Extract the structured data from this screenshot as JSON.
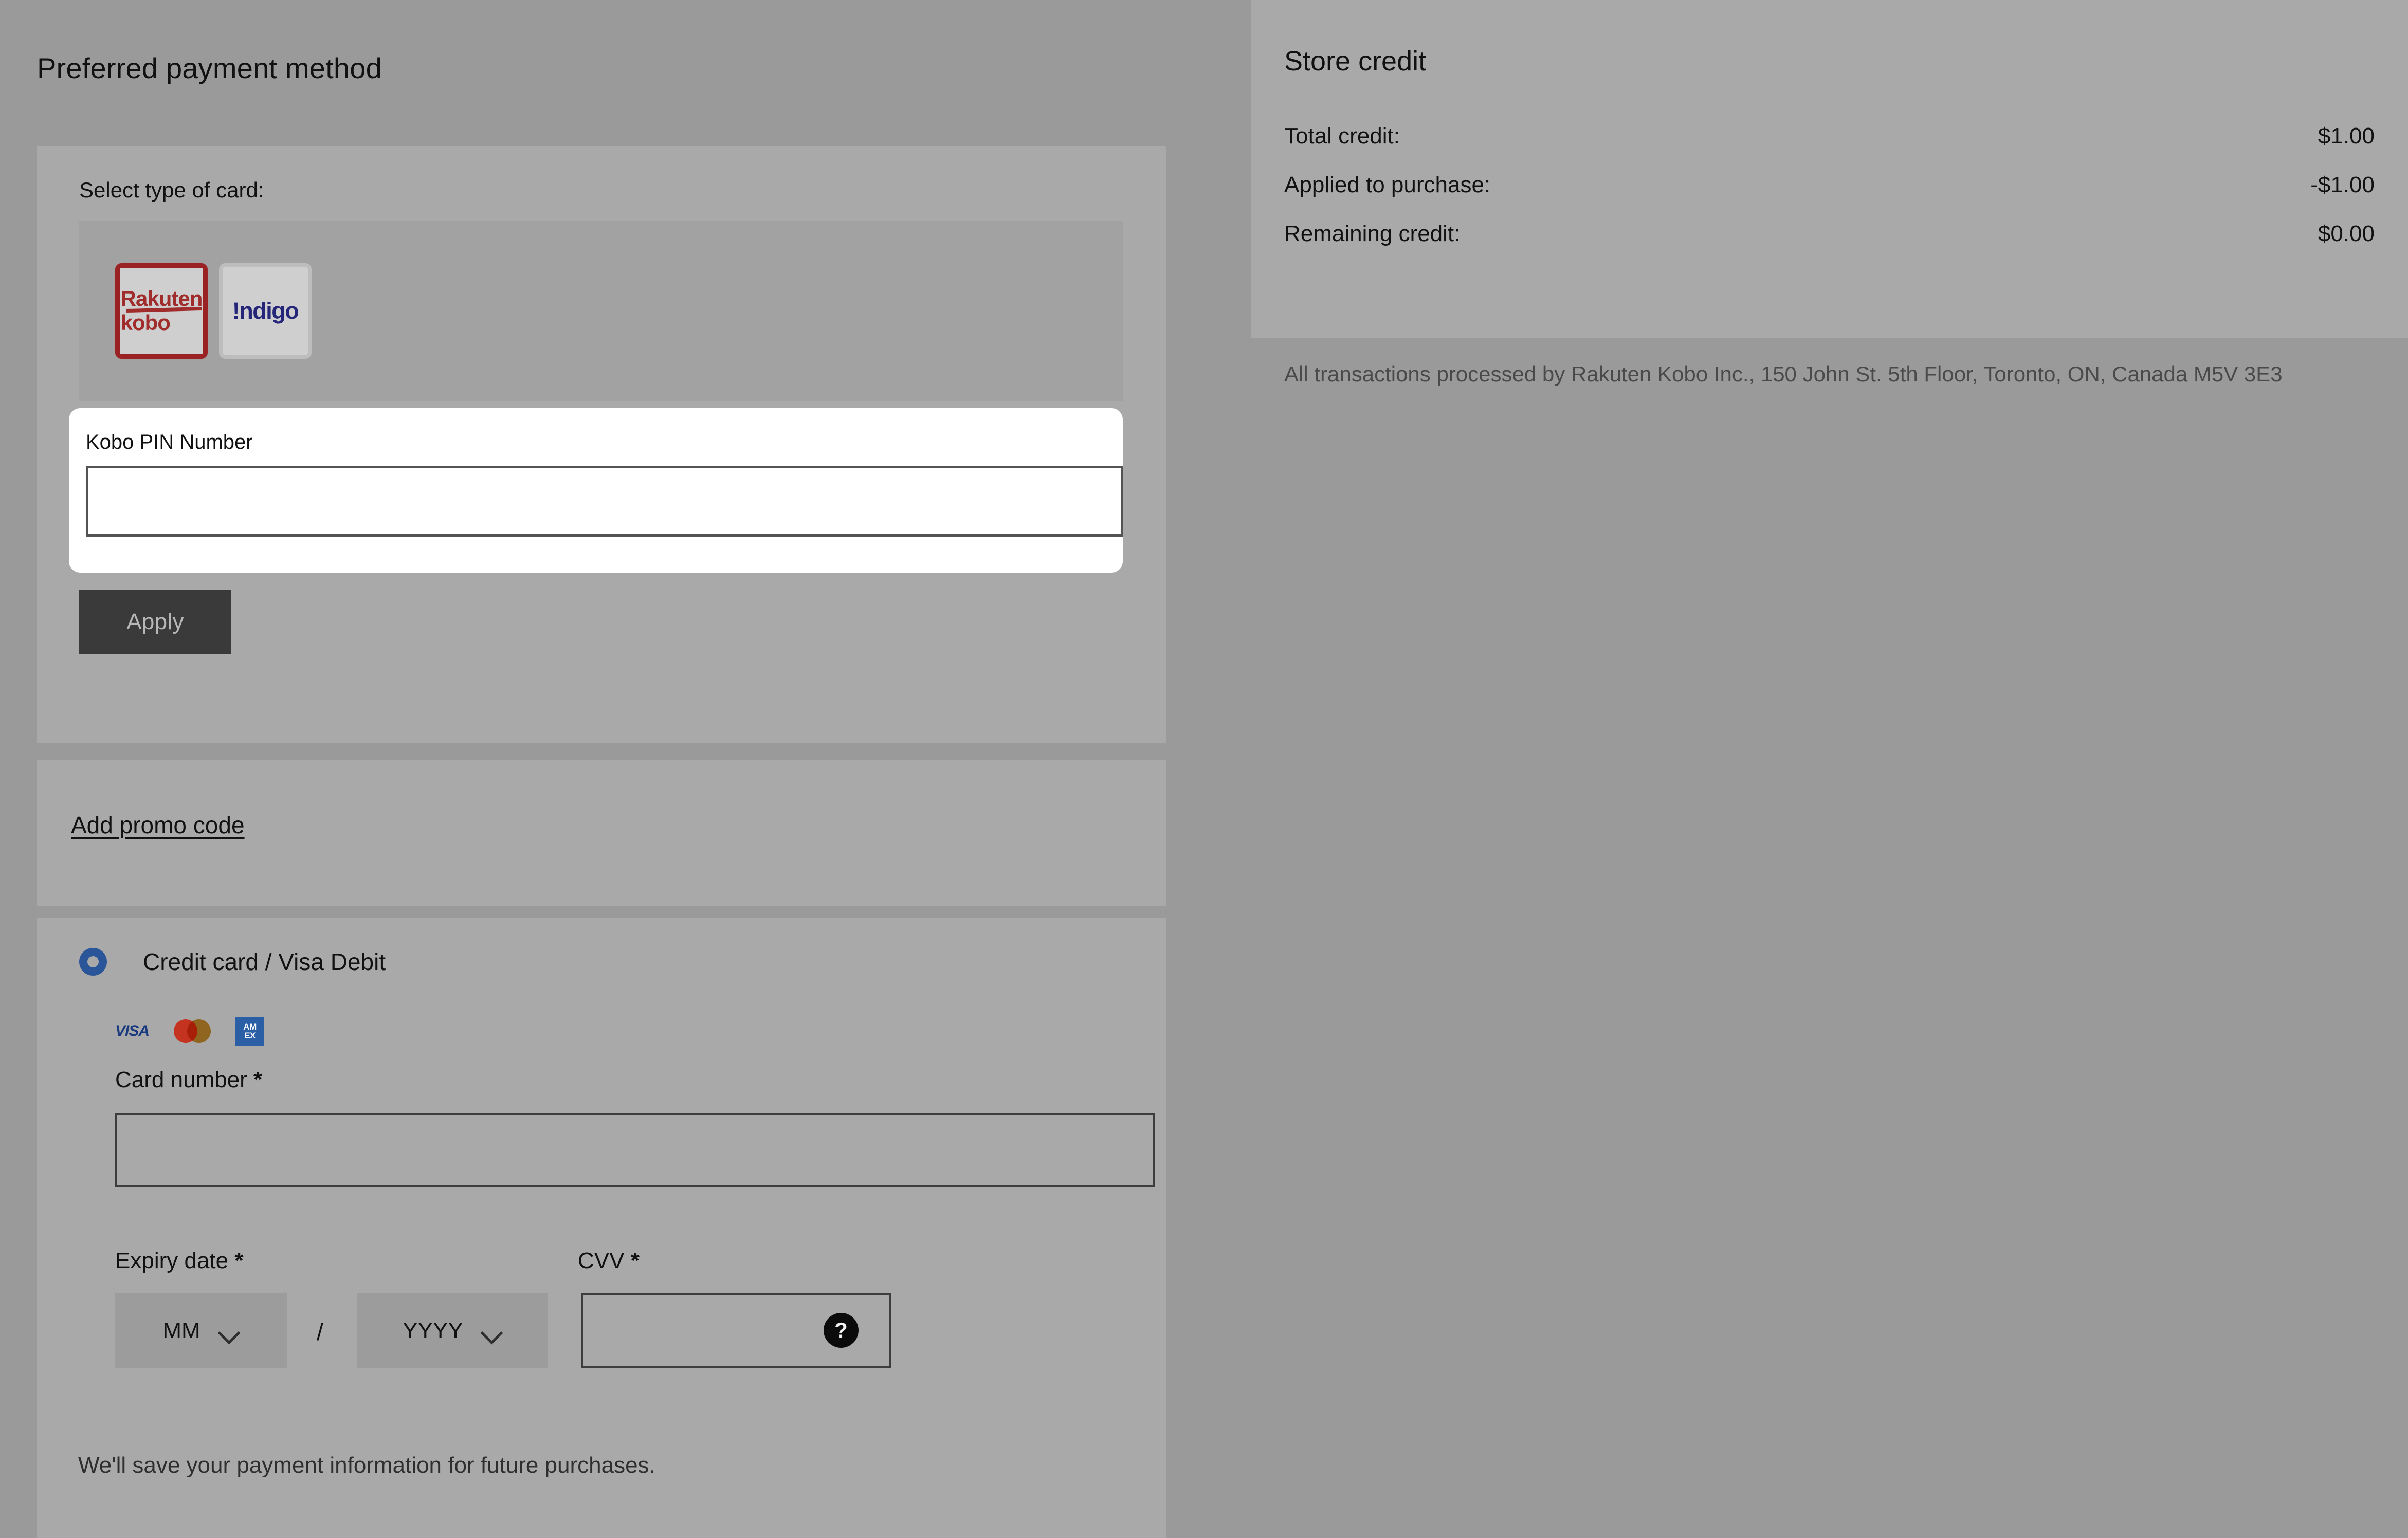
{
  "page": {
    "title": "Preferred payment method",
    "bg_color": "#9a9a9a",
    "panel_color": "#a9a9a9"
  },
  "card_type": {
    "label": "Select type of card:",
    "options": [
      {
        "name": "rakuten-kobo",
        "line1": "Rakuten",
        "line2": "kobo",
        "selected": true,
        "accent": "#9b2222"
      },
      {
        "name": "indigo",
        "label": "!ndigo",
        "selected": false,
        "accent": "#25257a"
      }
    ]
  },
  "pin": {
    "label": "Kobo PIN Number",
    "value": "",
    "placeholder": "",
    "focused": true
  },
  "apply": {
    "label": "Apply",
    "bg": "#3a3a3a",
    "fg": "#b7b7b7"
  },
  "promo": {
    "link_label": "Add promo code"
  },
  "credit_card": {
    "radio_label": "Credit card / Visa Debit",
    "radio_selected": true,
    "radio_color": "#2a5699",
    "brands": [
      {
        "name": "visa-logo",
        "label": "VISA"
      },
      {
        "name": "mastercard-logo",
        "label": "Mastercard"
      },
      {
        "name": "amex-logo",
        "line1": "AMERICAN",
        "line2": "EXPRESS",
        "short1": "AM",
        "short2": "EX"
      }
    ],
    "card_number": {
      "label": "Card number",
      "required_mark": "*",
      "value": "",
      "placeholder": ""
    },
    "expiry": {
      "label": "Expiry date",
      "required_mark": "*",
      "month_value": "MM",
      "year_value": "YYYY",
      "separator": "/"
    },
    "cvv": {
      "label": "CVV",
      "required_mark": "*",
      "value": "",
      "placeholder": "",
      "help_glyph": "?"
    },
    "save_note": "We'll save your payment information for future purchases."
  },
  "store_credit": {
    "title": "Store credit",
    "rows": [
      {
        "label": "Total credit:",
        "value": "$1.00"
      },
      {
        "label": "Applied to purchase:",
        "value": "-$1.00"
      },
      {
        "label": "Remaining credit:",
        "value": "$0.00"
      }
    ],
    "legal": "All transactions processed by Rakuten Kobo Inc., 150 John St. 5th Floor, Toronto, ON, Canada M5V 3E3"
  }
}
